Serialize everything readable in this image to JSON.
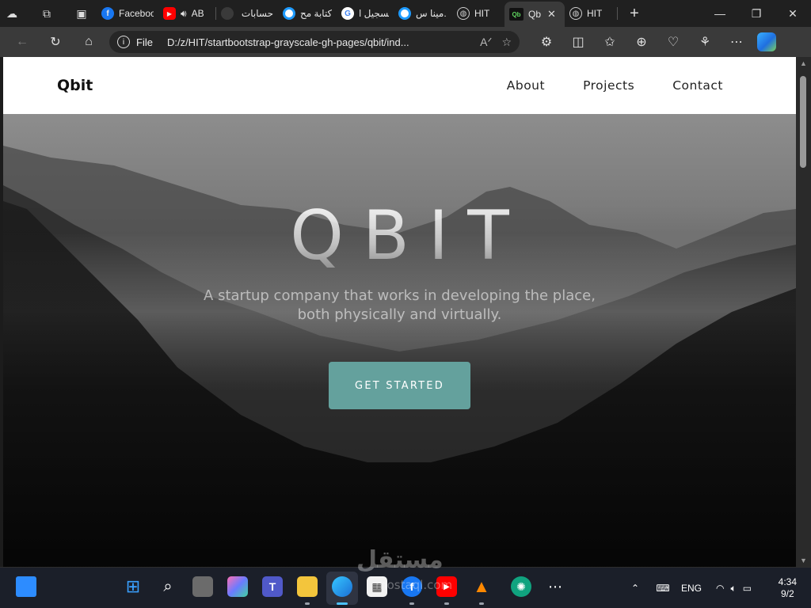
{
  "browser": {
    "tabs": [
      {
        "label": "Faceboo",
        "icon": "facebook-icon",
        "color": "#1877f2"
      },
      {
        "label": "AB",
        "icon": "youtube-icon",
        "color": "#ff0000"
      },
      {
        "label": "حسابات",
        "icon": "loading-icon",
        "color": "#444444"
      },
      {
        "label": "كتابة مح",
        "icon": "blue-circle-icon",
        "color": "#1e9bff"
      },
      {
        "label": "تسجيل ا",
        "icon": "google-icon",
        "color": "#ffffff"
      },
      {
        "label": "مينا س.",
        "icon": "blue-circle-icon",
        "color": "#1e9bff"
      },
      {
        "label": "HIT",
        "icon": "globe-icon",
        "color": "#cccccc"
      },
      {
        "label": "Qb",
        "icon": "qbit-favicon-icon",
        "color": "#2b8a3e",
        "active": true
      },
      {
        "label": "HIT",
        "icon": "globe-icon",
        "color": "#cccccc"
      }
    ],
    "address": {
      "scheme_label": "File",
      "url": "D:/z/HIT/startbootstrap-grayscale-gh-pages/qbit/ind..."
    }
  },
  "site": {
    "brand": "Qbit",
    "menu": [
      "About",
      "Projects",
      "Contact"
    ],
    "hero": {
      "title": "QBIT",
      "subtitle": "A startup company that works in developing the place, both physically and virtually.",
      "cta": "GET STARTED"
    },
    "accent": "#64a19d"
  },
  "taskbar": {
    "language": "ENG",
    "time": "4:34",
    "date": "9/2"
  },
  "watermark": {
    "arabic": "مستقل",
    "latin": "mostaql.com"
  }
}
